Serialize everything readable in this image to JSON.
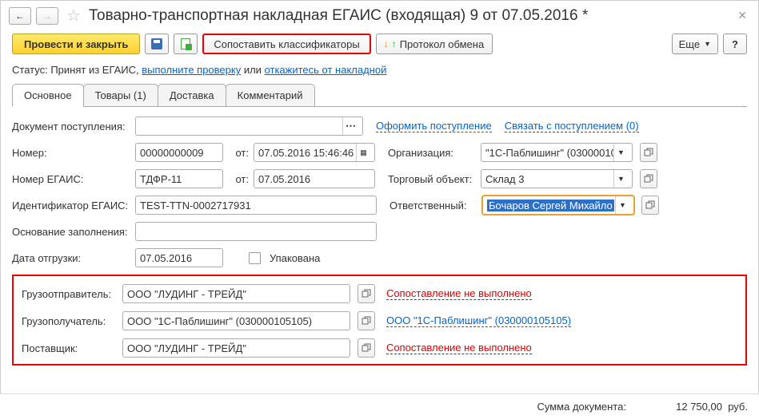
{
  "title": "Товарно-транспортная накладная ЕГАИС (входящая) 9 от 07.05.2016 *",
  "toolbar": {
    "post_close": "Провести и закрыть",
    "compare": "Сопоставить классификаторы",
    "protocol": "Протокол обмена",
    "more": "Еще",
    "help": "?"
  },
  "status": {
    "prefix": "Статус: Принят из ЕГАИС, ",
    "check": "выполните проверку",
    "or": " или ",
    "refuse": "откажитесь от накладной"
  },
  "tabs": {
    "main": "Основное",
    "goods": "Товары (1)",
    "delivery": "Доставка",
    "comment": "Комментарий"
  },
  "labels": {
    "doc_receipt": "Документ поступления:",
    "make_receipt": "Оформить поступление",
    "link_receipt": "Связать с поступлением (0)",
    "number": "Номер:",
    "from": "от:",
    "org": "Организация:",
    "egais_num": "Номер ЕГАИС:",
    "trade_obj": "Торговый объект:",
    "egais_id": "Идентификатор ЕГАИС:",
    "responsible": "Ответственный:",
    "basis": "Основание заполнения:",
    "ship_date": "Дата отгрузки:",
    "packed": "Упакована",
    "sender": "Грузоотправитель:",
    "receiver": "Грузополучатель:",
    "supplier": "Поставщик:",
    "not_matched": "Сопоставление не выполнено",
    "receiver_link": "ООО \"1С-Паблишинг\" (030000105105)"
  },
  "values": {
    "number": "00000000009",
    "date": "07.05.2016 15:46:46",
    "org": "\"1С-Паблишинг\" (03000010",
    "egais_num": "ТДФР-11",
    "egais_date": "07.05.2016",
    "trade_obj": "Склад 3",
    "egais_id": "TEST-TTN-0002717931",
    "responsible": "Бочаров Сергей Михайло",
    "ship_date": "07.05.2016",
    "sender": "ООО \"ЛУДИНГ - ТРЕЙД\"",
    "receiver": "ООО \"1С-Паблишинг\" (030000105105)",
    "supplier": "ООО \"ЛУДИНГ - ТРЕЙД\""
  },
  "footer": {
    "label": "Сумма документа:",
    "value": "12 750,00",
    "currency": "руб."
  }
}
